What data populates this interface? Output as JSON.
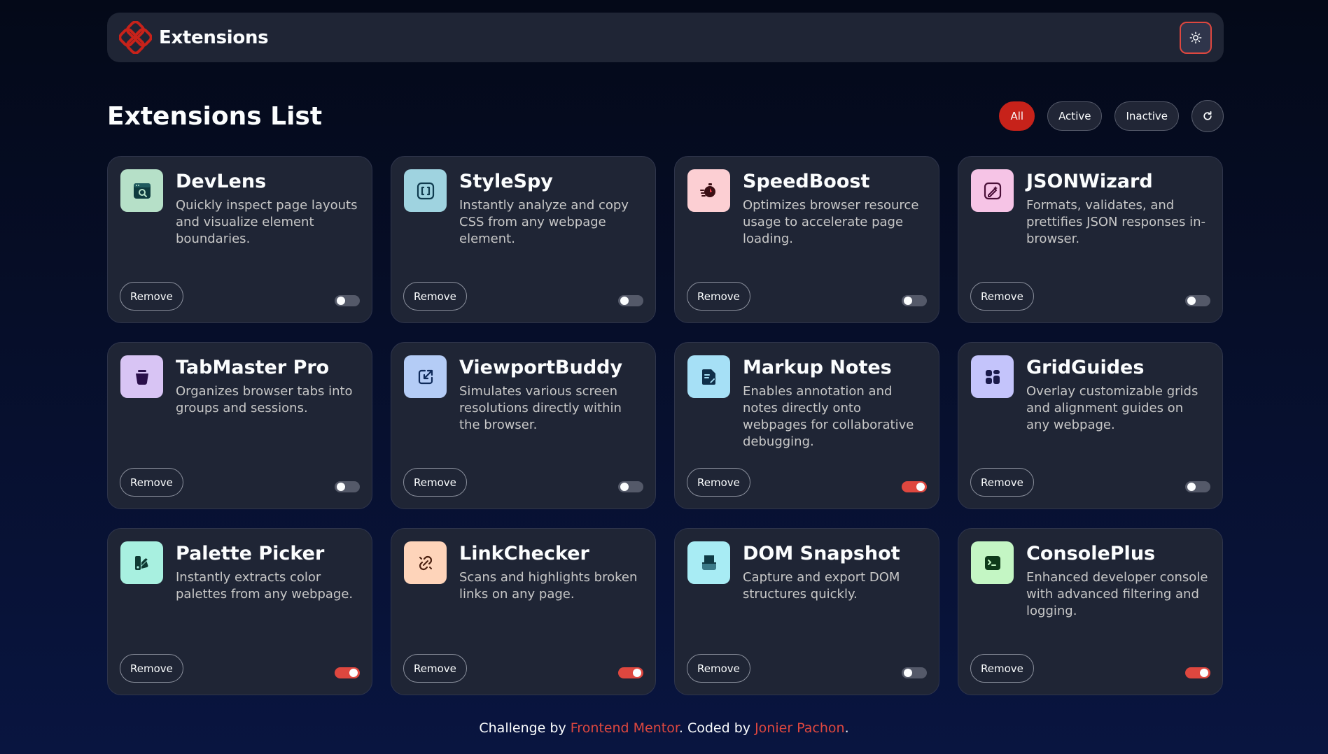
{
  "header": {
    "title": "Extensions"
  },
  "list": {
    "title": "Extensions List"
  },
  "filters": [
    {
      "label": "All",
      "active": true
    },
    {
      "label": "Active",
      "active": false
    },
    {
      "label": "Inactive",
      "active": false
    }
  ],
  "colors": {
    "accent": "#de473f",
    "card_bg": "#1f2535",
    "page_bg": "#040918"
  },
  "cards": [
    {
      "name": "DevLens",
      "desc": "Quickly inspect page layouts and visualize element boundaries.",
      "remove": "Remove",
      "active": false,
      "icon": "devlens-icon",
      "icon_bg": "#b6e0c8"
    },
    {
      "name": "StyleSpy",
      "desc": "Instantly analyze and copy CSS from any webpage element.",
      "remove": "Remove",
      "active": false,
      "icon": "stylespy-icon",
      "icon_bg": "#9fd3e0"
    },
    {
      "name": "SpeedBoost",
      "desc": "Optimizes browser resource usage to accelerate page loading.",
      "remove": "Remove",
      "active": false,
      "icon": "speedboost-icon",
      "icon_bg": "#fccfd3"
    },
    {
      "name": "JSONWizard",
      "desc": "Formats, validates, and prettifies JSON responses in-browser.",
      "remove": "Remove",
      "active": false,
      "icon": "jsonwizard-icon",
      "icon_bg": "#f6c4e6"
    },
    {
      "name": "TabMaster Pro",
      "desc": "Organizes browser tabs into groups and sessions.",
      "remove": "Remove",
      "active": false,
      "icon": "tabmaster-icon",
      "icon_bg": "#d8c4f4"
    },
    {
      "name": "ViewportBuddy",
      "desc": "Simulates various screen resolutions directly within the browser.",
      "remove": "Remove",
      "active": false,
      "icon": "viewportbuddy-icon",
      "icon_bg": "#b4ccf6"
    },
    {
      "name": "Markup Notes",
      "desc": "Enables annotation and notes directly onto webpages for collaborative debugging.",
      "remove": "Remove",
      "active": true,
      "icon": "markup-notes-icon",
      "icon_bg": "#a6e0f6"
    },
    {
      "name": "GridGuides",
      "desc": "Overlay customizable grids and alignment guides on any webpage.",
      "remove": "Remove",
      "active": false,
      "icon": "gridguides-icon",
      "icon_bg": "#c4c4fb"
    },
    {
      "name": "Palette Picker",
      "desc": "Instantly extracts color palettes from any webpage.",
      "remove": "Remove",
      "active": true,
      "icon": "palette-picker-icon",
      "icon_bg": "#a8f0e0"
    },
    {
      "name": "LinkChecker",
      "desc": "Scans and highlights broken links on any page.",
      "remove": "Remove",
      "active": true,
      "icon": "linkchecker-icon",
      "icon_bg": "#fed4ba"
    },
    {
      "name": "DOM Snapshot",
      "desc": "Capture and export DOM structures quickly.",
      "remove": "Remove",
      "active": false,
      "icon": "dom-snapshot-icon",
      "icon_bg": "#a8ecf4"
    },
    {
      "name": "ConsolePlus",
      "desc": "Enhanced developer console with advanced filtering and logging.",
      "remove": "Remove",
      "active": true,
      "icon": "consoleplus-icon",
      "icon_bg": "#c4f6c4"
    }
  ],
  "footer": {
    "prefix": "Challenge by ",
    "link1": "Frontend Mentor",
    "middle": ". Coded by ",
    "link2": "Jonier Pachon",
    "suffix": "."
  }
}
